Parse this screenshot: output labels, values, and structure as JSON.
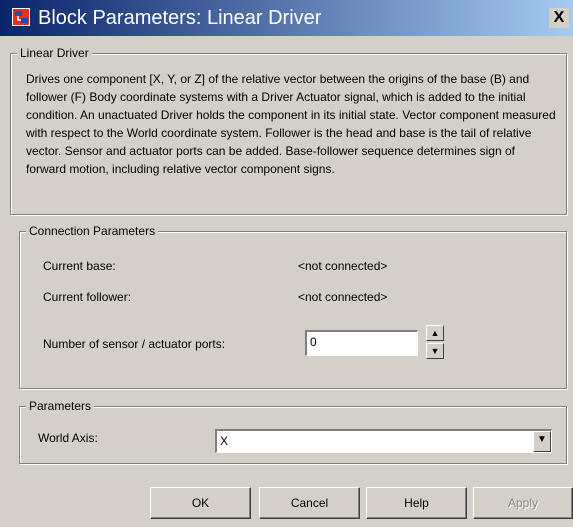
{
  "window": {
    "title": "Block Parameters: Linear Driver",
    "close_label": "X"
  },
  "description_group": {
    "title": "Linear Driver",
    "text": "Drives one component [X, Y, or Z] of the relative vector between the origins of the base (B) and follower (F) Body coordinate systems with a Driver Actuator signal, which is added to the initial condition. An unactuated Driver holds the component in its initial state. Vector component measured with respect to the World coordinate system. Follower is the head and base is the tail of relative vector. Sensor and actuator ports can be added. Base-follower sequence determines sign of forward motion, including relative vector component signs."
  },
  "connection_group": {
    "title": "Connection Parameters",
    "current_base_label": "Current base:",
    "current_base_value": "<not connected>",
    "current_follower_label": "Current follower:",
    "current_follower_value": "<not connected>",
    "ports_label": "Number of sensor / actuator ports:",
    "ports_value": "0",
    "spin_up": "▲",
    "spin_down": "▼"
  },
  "parameters_group": {
    "title": "Parameters",
    "axis_label": "World Axis:",
    "axis_value": "X",
    "dropdown_arrow": "▼"
  },
  "buttons": {
    "ok": "OK",
    "cancel": "Cancel",
    "help": "Help",
    "apply": "Apply"
  },
  "colors": {
    "title_bar_start": "#0a246a",
    "title_bar_end": "#a6caf0",
    "face": "#d4d0c8"
  }
}
